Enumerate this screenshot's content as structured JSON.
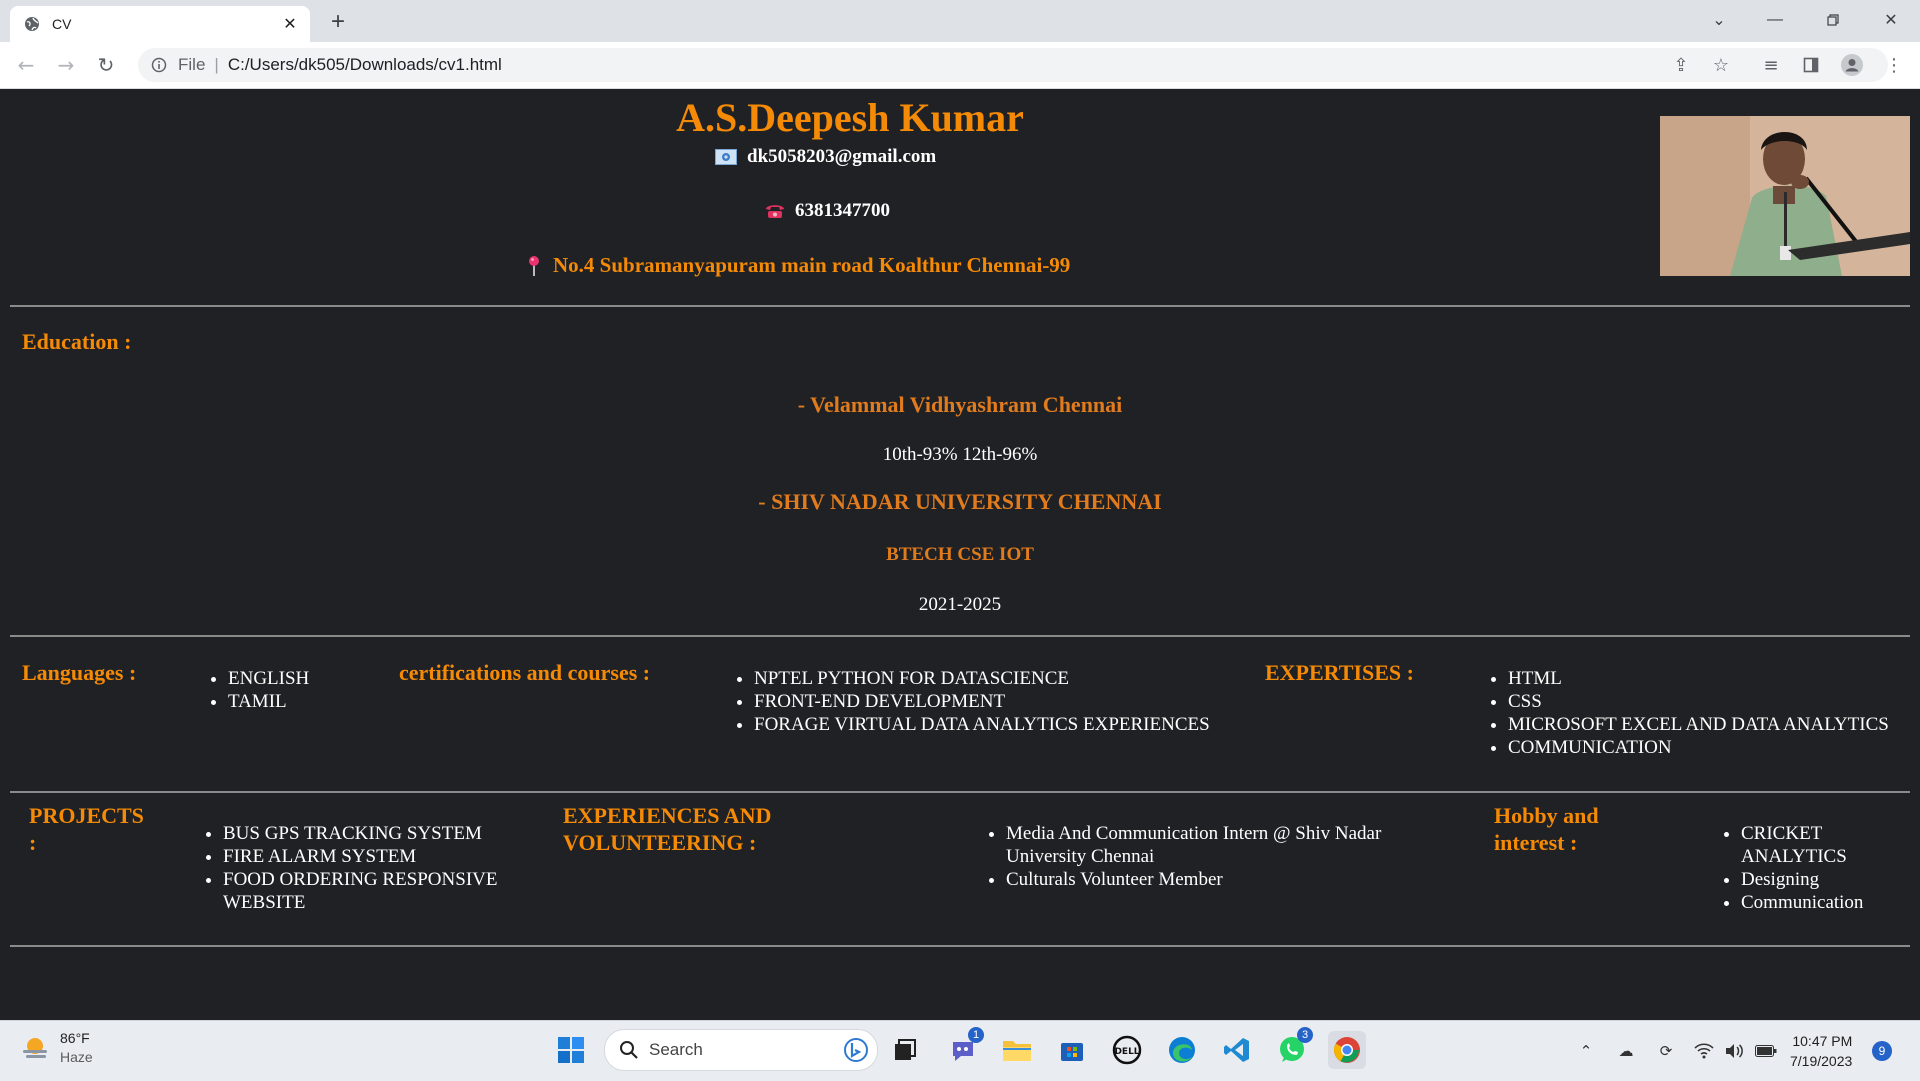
{
  "browser": {
    "tab_title": "CV",
    "scheme_label": "File",
    "url": "C:/Users/dk505/Downloads/cv1.html"
  },
  "cv": {
    "name": "A.S.Deepesh Kumar",
    "email": "dk5058203@gmail.com",
    "phone": "6381347700",
    "address": "No.4 Subramanyapuram main road Koalthur Chennai-99",
    "education": {
      "heading": "Education :",
      "school": "- Velammal Vidhyashram Chennai",
      "school_marks": "10th-93% 12th-96%",
      "university": "- SHIV NADAR UNIVERSITY CHENNAI",
      "degree": "BTECH CSE IOT",
      "years": "2021-2025"
    },
    "languages": {
      "heading": "Languages :",
      "items": [
        "ENGLISH",
        "TAMIL"
      ]
    },
    "certifications": {
      "heading": "certifications and courses :",
      "items": [
        "NPTEL PYTHON FOR DATASCIENCE",
        "FRONT-END DEVELOPMENT",
        "FORAGE VIRTUAL DATA ANALYTICS EXPERIENCES"
      ]
    },
    "expertises": {
      "heading": "EXPERTISES :",
      "items": [
        "HTML",
        "CSS",
        "MICROSOFT EXCEL AND DATA ANALYTICS",
        "COMMUNICATION"
      ]
    },
    "projects": {
      "heading_line1": "PROJECTS",
      "heading_line2": ":",
      "items": [
        "BUS GPS TRACKING SYSTEM",
        "FIRE ALARM SYSTEM",
        "FOOD ORDERING RESPONSIVE WEBSITE"
      ]
    },
    "experiences": {
      "heading_line1": "EXPERIENCES AND",
      "heading_line2": "VOLUNTEERING :",
      "items": [
        "Media And Communication Intern @ Shiv Nadar University Chennai",
        "Culturals Volunteer Member"
      ]
    },
    "hobbies": {
      "heading_line1": "Hobby and",
      "heading_line2": "interest :",
      "items": [
        "CRICKET ANALYTICS",
        "Designing",
        "Communication"
      ]
    }
  },
  "taskbar": {
    "weather_temp": "86°F",
    "weather_desc": "Haze",
    "search_label": "Search",
    "teams_badge": "1",
    "whatsapp_badge": "3",
    "time": "10:47 PM",
    "date": "7/19/2023",
    "notification_count": "9"
  },
  "colors": {
    "accent": "#f58a07",
    "page_bg": "#202124",
    "text": "#ffffff"
  }
}
